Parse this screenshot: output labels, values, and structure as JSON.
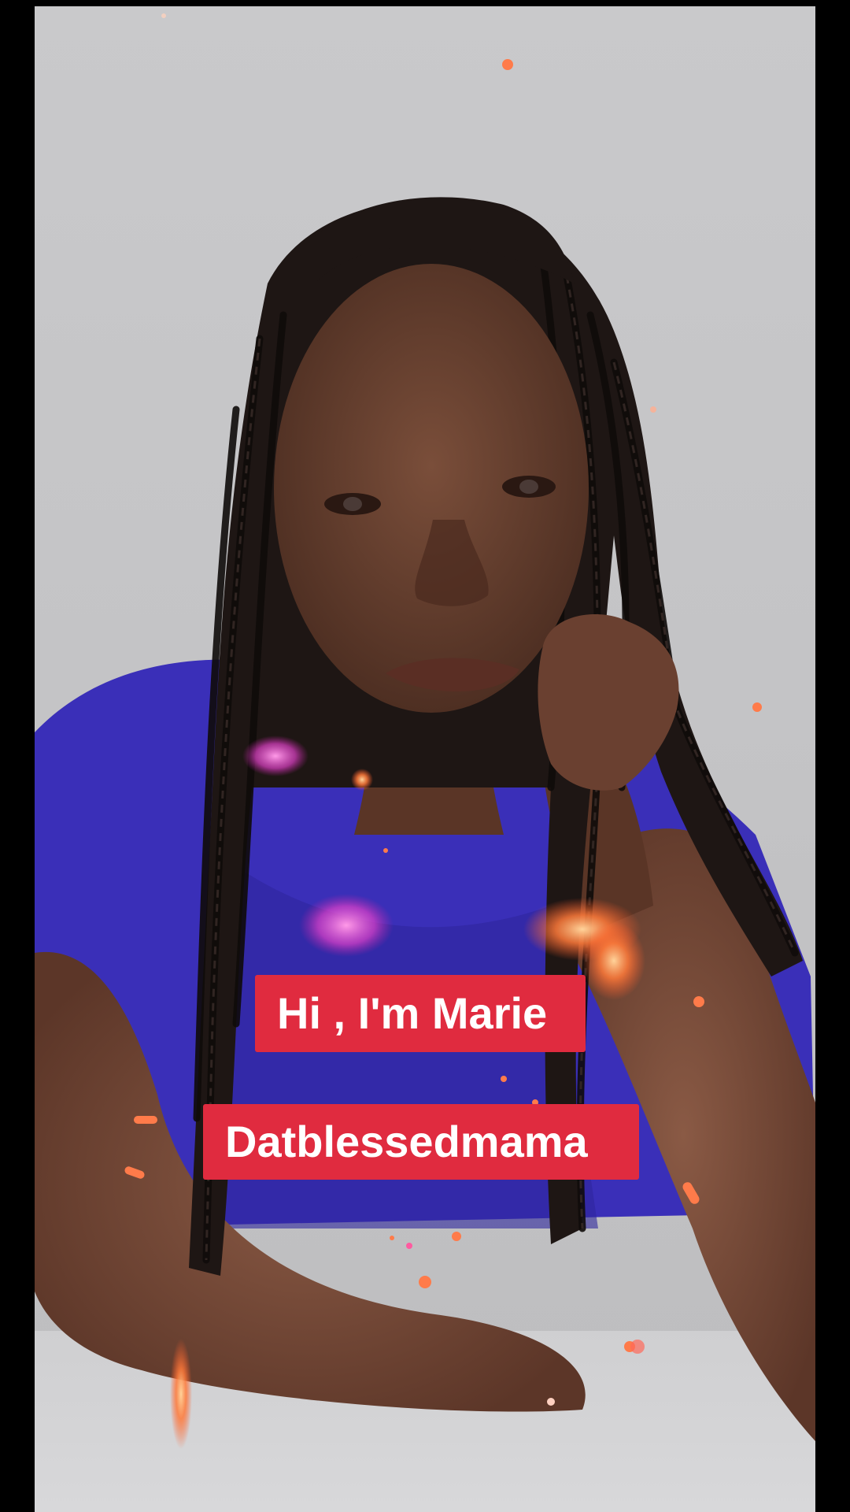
{
  "video": {
    "captions": {
      "greeting": "Hi , I'm Marie",
      "username": "Datblessedmama"
    },
    "colors": {
      "caption_background": "#e02b3f",
      "caption_text": "#ffffff",
      "backdrop": "#c6c6c8",
      "shirt": "#3a2fb8"
    }
  }
}
